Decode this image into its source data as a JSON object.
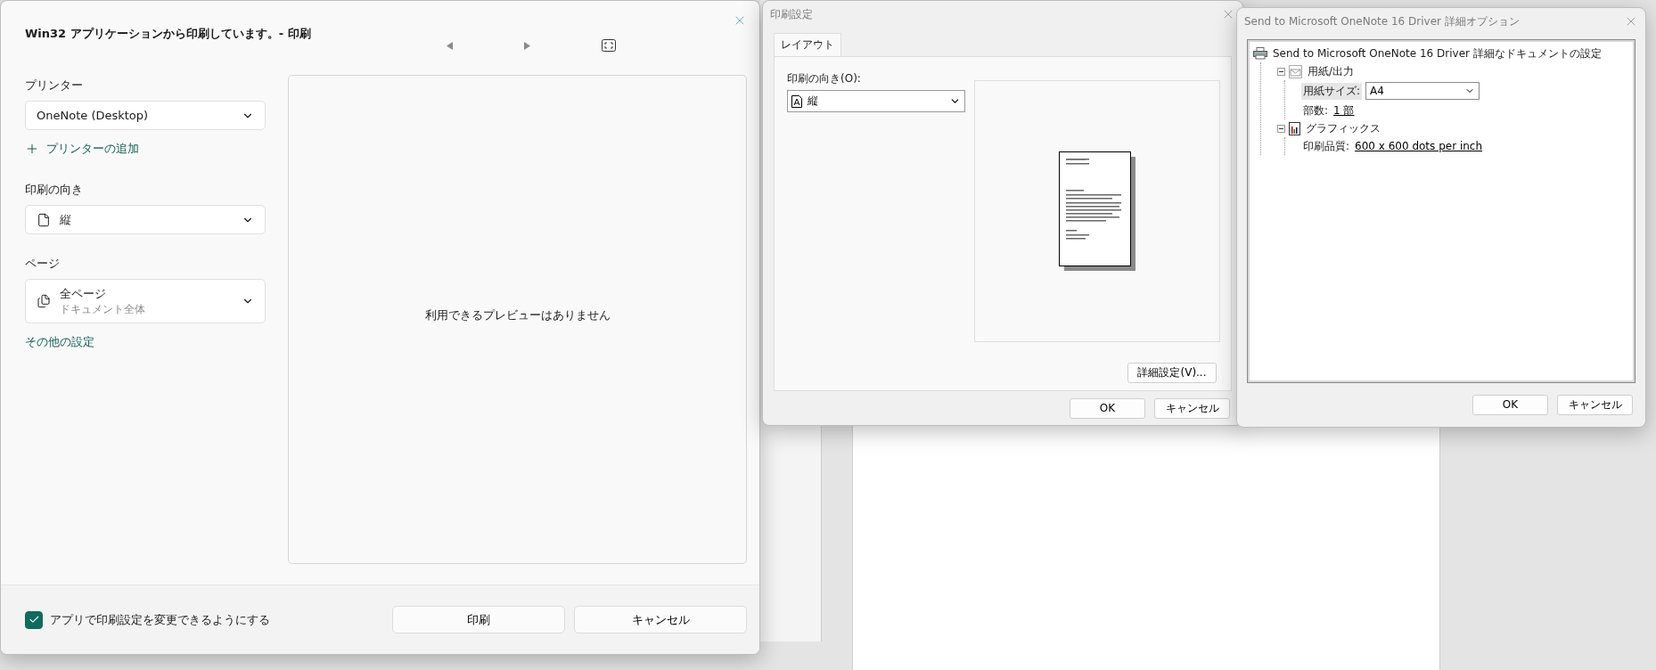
{
  "print_dialog": {
    "title": "Win32 アプリケーションから印刷しています。- 印刷",
    "printer": {
      "label": "プリンター",
      "value": "OneNote (Desktop)"
    },
    "add_printer": "プリンターの追加",
    "orientation": {
      "label": "印刷の向き",
      "value": "縦"
    },
    "pages": {
      "label": "ページ",
      "value": "全ページ",
      "hint": "ドキュメント全体"
    },
    "more_settings": "その他の設定",
    "preview_message": "利用できるプレビューはありません",
    "allow_app_settings": {
      "label": "アプリで印刷設定を変更できるようにする",
      "checked": true
    },
    "buttons": [
      "印刷",
      "キャンセル"
    ]
  },
  "settings_dialog": {
    "title": "印刷設定",
    "tabs": [
      {
        "label": "レイアウト",
        "selected": true
      }
    ],
    "orientation": {
      "label": "印刷の向き(O):",
      "value": "縦"
    },
    "advanced_button": "詳細設定(V)...",
    "buttons": [
      "OK",
      "キャンセル"
    ]
  },
  "advanced_dialog": {
    "title": "Send to Microsoft OneNote 16 Driver 詳細オプション",
    "tree": [
      {
        "kind": "root",
        "label": "Send to Microsoft OneNote 16 Driver 詳細なドキュメントの設定",
        "children": [
          {
            "kind": "group",
            "label": "用紙/出力",
            "expanded": true,
            "children": [
              {
                "kind": "select",
                "label": "用紙サイズ:",
                "value": "A4",
                "selected": true
              },
              {
                "kind": "link",
                "label": "部数:",
                "value": "1 部",
                "selected": false
              }
            ]
          },
          {
            "kind": "group",
            "label": "グラフィックス",
            "expanded": true,
            "children": [
              {
                "kind": "link",
                "label": "印刷品質:",
                "value": "600 x 600 dots per inch",
                "selected": false
              }
            ]
          }
        ]
      }
    ],
    "buttons": [
      "OK",
      "キャンセル"
    ]
  }
}
